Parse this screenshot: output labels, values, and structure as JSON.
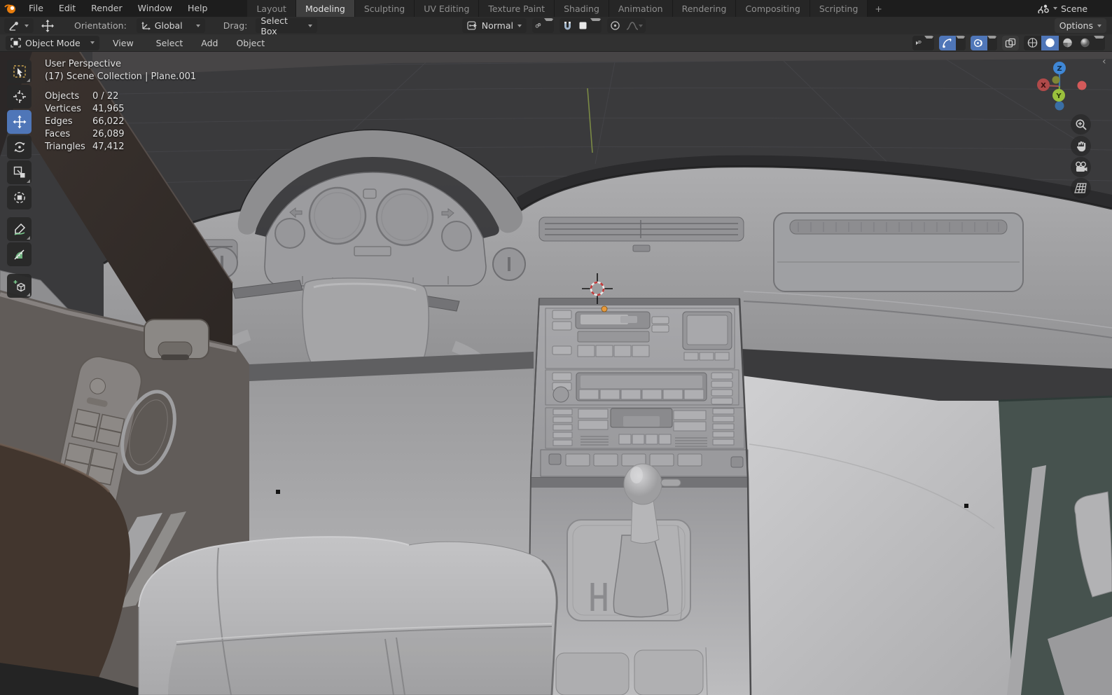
{
  "topbar": {
    "menus": [
      "File",
      "Edit",
      "Render",
      "Window",
      "Help"
    ],
    "tabs": [
      "Layout",
      "Modeling",
      "Sculpting",
      "UV Editing",
      "Texture Paint",
      "Shading",
      "Animation",
      "Rendering",
      "Compositing",
      "Scripting",
      "+"
    ],
    "active_tab": "Modeling",
    "scene_label": "Scene"
  },
  "viewport_header": {
    "orientation_label": "Orientation:",
    "orientation_value": "Global",
    "drag_label": "Drag:",
    "drag_value": "Select Box",
    "pivot_value": "Normal",
    "options_label": "Options",
    "mode_value": "Object Mode",
    "menus": [
      "View",
      "Select",
      "Add",
      "Object"
    ]
  },
  "overlay": {
    "view_name": "User Perspective",
    "breadcrumb": "(17) Scene Collection | Plane.001",
    "stats": [
      {
        "label": "Objects",
        "value": "0 / 22"
      },
      {
        "label": "Vertices",
        "value": "41,965"
      },
      {
        "label": "Edges",
        "value": "66,022"
      },
      {
        "label": "Faces",
        "value": "26,089"
      },
      {
        "label": "Triangles",
        "value": "47,412"
      }
    ]
  },
  "axis_gizmo": {
    "x": "X",
    "y": "Y",
    "z": "Z"
  },
  "icons": {
    "logo": "blender-logo",
    "scene": "scene-icon",
    "tool": "active-tool-icon",
    "move": "move-icon",
    "snap": "snap-icon",
    "magnet": "magnet-icon",
    "proportional": "proportional-edit-icon",
    "falloff": "falloff-curve-icon",
    "visibility": "show-object-types-icon",
    "gizmos": "gizmos-icon",
    "overlays": "overlays-icon",
    "xray": "xray-toggle-icon",
    "wireframe": "wireframe-shading-icon",
    "solid": "solid-shading-icon",
    "material": "material-preview-icon",
    "rendered": "rendered-shading-icon",
    "zoom": "zoom-icon",
    "pan": "pan-hand-icon",
    "camera": "camera-view-icon",
    "ortho": "toggle-ortho-icon"
  },
  "colors": {
    "accent_blue": "#4f76b8",
    "axis_x": "#c94b4b",
    "axis_y": "#9ec33b",
    "axis_z": "#3f87d6",
    "origin_orange": "#e79a3c",
    "viewport_bg": "#3a3a3c"
  }
}
